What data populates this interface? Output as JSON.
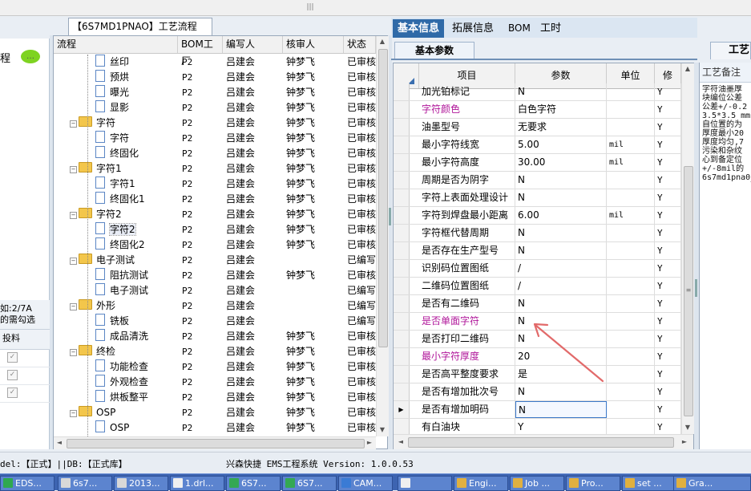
{
  "tree_panel": {
    "title": "【6S7MD1PNAO】工艺流程",
    "columns": [
      "流程",
      "BOM工厂",
      "编写人",
      "核审人",
      "状态"
    ],
    "rows": [
      {
        "name": "丝印",
        "type": "doc",
        "level": 2,
        "bom": "P2",
        "writer": "吕建会",
        "reviewer": "钟梦飞",
        "status": "已审核"
      },
      {
        "name": "预烘",
        "type": "doc",
        "level": 2,
        "bom": "P2",
        "writer": "吕建会",
        "reviewer": "钟梦飞",
        "status": "已审核"
      },
      {
        "name": "曝光",
        "type": "doc",
        "level": 2,
        "bom": "P2",
        "writer": "吕建会",
        "reviewer": "钟梦飞",
        "status": "已审核"
      },
      {
        "name": "显影",
        "type": "doc",
        "level": 2,
        "bom": "P2",
        "writer": "吕建会",
        "reviewer": "钟梦飞",
        "status": "已审核"
      },
      {
        "name": "字符",
        "type": "folder",
        "level": 1,
        "bom": "P2",
        "writer": "吕建会",
        "reviewer": "钟梦飞",
        "status": "已审核"
      },
      {
        "name": "字符",
        "type": "doc",
        "level": 2,
        "bom": "P2",
        "writer": "吕建会",
        "reviewer": "钟梦飞",
        "status": "已审核"
      },
      {
        "name": "终固化",
        "type": "doc",
        "level": 2,
        "bom": "P2",
        "writer": "吕建会",
        "reviewer": "钟梦飞",
        "status": "已审核"
      },
      {
        "name": "字符1",
        "type": "folder",
        "level": 1,
        "bom": "P2",
        "writer": "吕建会",
        "reviewer": "钟梦飞",
        "status": "已审核"
      },
      {
        "name": "字符1",
        "type": "doc",
        "level": 2,
        "bom": "P2",
        "writer": "吕建会",
        "reviewer": "钟梦飞",
        "status": "已审核"
      },
      {
        "name": "终固化1",
        "type": "doc",
        "level": 2,
        "bom": "P2",
        "writer": "吕建会",
        "reviewer": "钟梦飞",
        "status": "已审核"
      },
      {
        "name": "字符2",
        "type": "folder",
        "level": 1,
        "bom": "P2",
        "writer": "吕建会",
        "reviewer": "钟梦飞",
        "status": "已审核"
      },
      {
        "name": "字符2",
        "type": "doc",
        "level": 2,
        "bom": "P2",
        "writer": "吕建会",
        "reviewer": "钟梦飞",
        "status": "已审核",
        "selected": true
      },
      {
        "name": "终固化2",
        "type": "doc",
        "level": 2,
        "bom": "P2",
        "writer": "吕建会",
        "reviewer": "钟梦飞",
        "status": "已审核"
      },
      {
        "name": "电子测试",
        "type": "folder",
        "level": 1,
        "bom": "P2",
        "writer": "吕建会",
        "reviewer": "",
        "status": "已编写"
      },
      {
        "name": "阻抗测试",
        "type": "doc",
        "level": 2,
        "bom": "P2",
        "writer": "吕建会",
        "reviewer": "钟梦飞",
        "status": "已审核"
      },
      {
        "name": "电子测试",
        "type": "doc",
        "level": 2,
        "bom": "P2",
        "writer": "吕建会",
        "reviewer": "",
        "status": "已编写"
      },
      {
        "name": "外形",
        "type": "folder",
        "level": 1,
        "bom": "P2",
        "writer": "吕建会",
        "reviewer": "",
        "status": "已编写"
      },
      {
        "name": "铣板",
        "type": "doc",
        "level": 2,
        "bom": "P2",
        "writer": "吕建会",
        "reviewer": "",
        "status": "已编写"
      },
      {
        "name": "成品清洗",
        "type": "doc",
        "level": 2,
        "bom": "P2",
        "writer": "吕建会",
        "reviewer": "钟梦飞",
        "status": "已审核"
      },
      {
        "name": "终检",
        "type": "folder",
        "level": 1,
        "bom": "P2",
        "writer": "吕建会",
        "reviewer": "钟梦飞",
        "status": "已审核"
      },
      {
        "name": "功能检查",
        "type": "doc",
        "level": 2,
        "bom": "P2",
        "writer": "吕建会",
        "reviewer": "钟梦飞",
        "status": "已审核"
      },
      {
        "name": "外观检查",
        "type": "doc",
        "level": 2,
        "bom": "P2",
        "writer": "吕建会",
        "reviewer": "钟梦飞",
        "status": "已审核"
      },
      {
        "name": "烘板整平",
        "type": "doc",
        "level": 2,
        "bom": "P2",
        "writer": "吕建会",
        "reviewer": "钟梦飞",
        "status": "已审核"
      },
      {
        "name": "OSP",
        "type": "folder",
        "level": 1,
        "bom": "P2",
        "writer": "吕建会",
        "reviewer": "钟梦飞",
        "status": "已审核"
      },
      {
        "name": "OSP",
        "type": "doc",
        "level": 2,
        "bom": "P2",
        "writer": "吕建会",
        "reviewer": "钟梦飞",
        "status": "已审核"
      }
    ]
  },
  "left_panel": {
    "label": "程",
    "hint_line1": "如:2/7A",
    "hint_line2": "的需勾选",
    "column_label": "投料"
  },
  "tabs": [
    "基本信息",
    "拓展信息",
    "BOM",
    "工时"
  ],
  "active_tab": 0,
  "subtab": "基本参数",
  "grid": {
    "columns": [
      "项目",
      "参数",
      "单位",
      "修"
    ],
    "rows": [
      {
        "item": "加光铂标记",
        "value": "N",
        "unit": "",
        "mod": "Y",
        "highlight": false
      },
      {
        "item": "字符颜色",
        "value": "白色字符",
        "unit": "",
        "mod": "Y",
        "highlight": true
      },
      {
        "item": "油墨型号",
        "value": "无要求",
        "unit": "",
        "mod": "Y",
        "highlight": false
      },
      {
        "item": "最小字符线宽",
        "value": "5.00",
        "unit": "mil",
        "mod": "Y",
        "highlight": false
      },
      {
        "item": "最小字符高度",
        "value": "30.00",
        "unit": "mil",
        "mod": "Y",
        "highlight": false
      },
      {
        "item": "周期是否为阴字",
        "value": "N",
        "unit": "",
        "mod": "Y",
        "highlight": false
      },
      {
        "item": "字符上表面处理设计",
        "value": "N",
        "unit": "",
        "mod": "Y",
        "highlight": false
      },
      {
        "item": "字符到焊盘最小距离",
        "value": "6.00",
        "unit": "mil",
        "mod": "Y",
        "highlight": false
      },
      {
        "item": "字符框代替周期",
        "value": "N",
        "unit": "",
        "mod": "Y",
        "highlight": false
      },
      {
        "item": "是否存在生产型号",
        "value": "N",
        "unit": "",
        "mod": "Y",
        "highlight": false
      },
      {
        "item": "识别码位置图纸",
        "value": "/",
        "unit": "",
        "mod": "Y",
        "highlight": false
      },
      {
        "item": "二维码位置图纸",
        "value": "/",
        "unit": "",
        "mod": "Y",
        "highlight": false
      },
      {
        "item": "是否有二维码",
        "value": "N",
        "unit": "",
        "mod": "Y",
        "highlight": false
      },
      {
        "item": "是否单面字符",
        "value": "N",
        "unit": "",
        "mod": "Y",
        "highlight": true
      },
      {
        "item": "是否打印二维码",
        "value": "N",
        "unit": "",
        "mod": "Y",
        "highlight": false
      },
      {
        "item": "最小字符厚度",
        "value": "20",
        "unit": "",
        "mod": "Y",
        "highlight": true
      },
      {
        "item": "是否高平整度要求",
        "value": "是",
        "unit": "",
        "mod": "Y",
        "highlight": false
      },
      {
        "item": "是否有增加批次号",
        "value": "N",
        "unit": "",
        "mod": "Y",
        "highlight": false
      },
      {
        "item": "是否有增加明码",
        "value": "N",
        "unit": "",
        "mod": "Y",
        "highlight": false,
        "current": true
      },
      {
        "item": "有白油块",
        "value": "Y",
        "unit": "",
        "mod": "Y",
        "highlight": false
      }
    ]
  },
  "notes": {
    "tab": "工艺",
    "label": "工艺备注",
    "text": "字符油墨厚\n块编位公差\n公差+/-0.2\n3.5*3.5 mm\n自位置的为\n厚度最小20\n厚度均匀,7\n污染和杂纹\n心到备定位\n+/-8mil的\n6s7md1pna0_"
  },
  "status": {
    "left": "del:【正式】||DB:【正式库】",
    "center": "兴森快捷 EMS工程系统 Version: 1.0.0.53"
  },
  "taskbar": [
    {
      "label": "EDS...",
      "color": "#2fa84f"
    },
    {
      "label": "6s7...",
      "color": "#d8d8d8"
    },
    {
      "label": "2013...",
      "color": "#d8d8d8"
    },
    {
      "label": "1.drl...",
      "color": "#f0f0f0"
    },
    {
      "label": "6S7...",
      "color": "#34a853"
    },
    {
      "label": "6S7...",
      "color": "#34a853"
    },
    {
      "label": "CAM...",
      "color": "#3a7bd5"
    },
    {
      "label": "",
      "color": "#f0f0f0"
    },
    {
      "label": "Engi...",
      "color": "#e0b040"
    },
    {
      "label": "Job ...",
      "color": "#e0b040"
    },
    {
      "label": "Pro...",
      "color": "#e0b040"
    },
    {
      "label": "set ...",
      "color": "#e0b040"
    },
    {
      "label": "Gra...",
      "color": "#e0b040"
    }
  ],
  "colors": {
    "accent": "#2f6aa8",
    "highlight_text": "#b0169a",
    "arrow": "#e26a6a",
    "folder": "#f3c64b"
  }
}
